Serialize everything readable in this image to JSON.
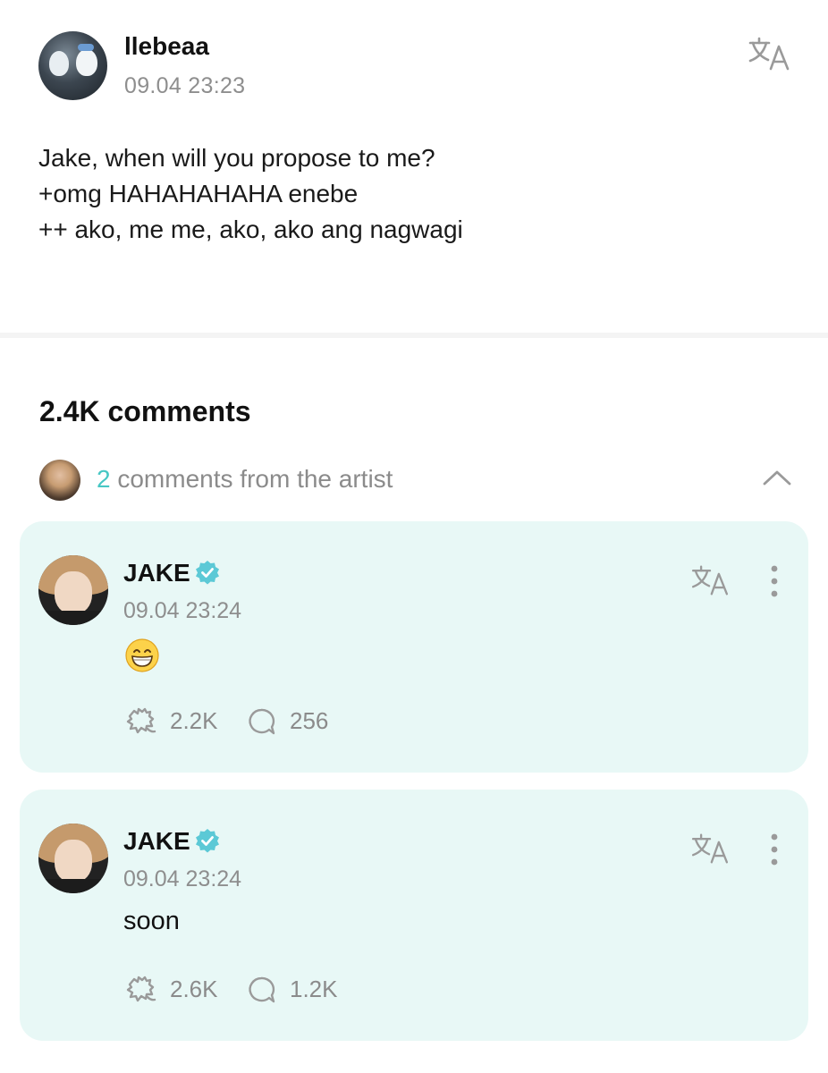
{
  "post": {
    "author": "llebeaa",
    "timestamp": "09.04 23:23",
    "text_lines": [
      "Jake, when will you propose to me?",
      "",
      "+omg HAHAHAHAHA enebe",
      "++ ako, me me, ako, ako ang nagwagi"
    ]
  },
  "comments": {
    "title": "2.4K comments",
    "artist_summary": {
      "count": "2",
      "label": "comments from the artist"
    },
    "items": [
      {
        "author": "JAKE",
        "timestamp": "09.04 23:24",
        "content_emoji": "grinning-face-with-smiling-eyes",
        "text": "",
        "likes": "2.2K",
        "replies": "256"
      },
      {
        "author": "JAKE",
        "timestamp": "09.04 23:24",
        "text": "soon",
        "likes": "2.6K",
        "replies": "1.2K"
      }
    ]
  },
  "icons": {
    "translate": "translate-icon",
    "more": "more-vertical-icon",
    "like": "like-icon",
    "reply": "reply-bubble-icon",
    "verified": "verified-badge-icon",
    "collapse": "chevron-up-icon"
  },
  "colors": {
    "accent": "#47c7c4",
    "card_background": "#e8f8f6",
    "muted_text": "#8e8e8e"
  }
}
